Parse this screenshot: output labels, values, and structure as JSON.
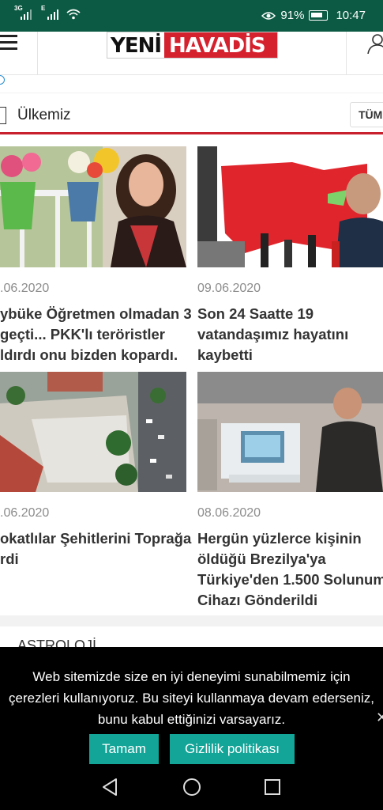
{
  "status_bar": {
    "net1": "3G",
    "net2": "E",
    "battery_pct": "91%",
    "time": "10:47"
  },
  "header": {
    "logo_part1": "YENİ",
    "logo_part2": "HAVADİS"
  },
  "section": {
    "title": "Ülkemiz",
    "all_button": "TÜM"
  },
  "news": [
    {
      "date": ".06.2020",
      "lines": [
        "ybüke Öğretmen olmadan 3",
        " geçti... PKK'lı teröristler",
        "ldırdı onu bizden kopardı."
      ]
    },
    {
      "date": "09.06.2020",
      "lines": [
        "Son 24 Saatte 19",
        "vatandaşımız hayatını",
        "kaybetti"
      ]
    },
    {
      "date": ".06.2020",
      "lines": [
        "okatlılar Şehitlerini Toprağa",
        "rdi"
      ]
    },
    {
      "date": "08.06.2020",
      "lines": [
        "Hergün yüzlerce kişinin",
        "öldüğü Brezilya'ya",
        "Türkiye'den 1.500 Solunum",
        "Cihazı Gönderildi"
      ]
    }
  ],
  "next_section": "ASTROLOJİ",
  "cookie": {
    "line1": "Web sitemizde size en iyi deneyimi sunabilmemiz için",
    "line2": "çerezleri kullanıyoruz. Bu siteyi kullanmaya devam ederseniz,",
    "line3": "bunu kabul ettiğinizi varsayarız.",
    "accept": "Tamam",
    "privacy": "Gizlilik politikası"
  },
  "colors": {
    "status_bar": "#0c5a43",
    "brand_red": "#d5212e",
    "accent_teal": "#13a598"
  }
}
